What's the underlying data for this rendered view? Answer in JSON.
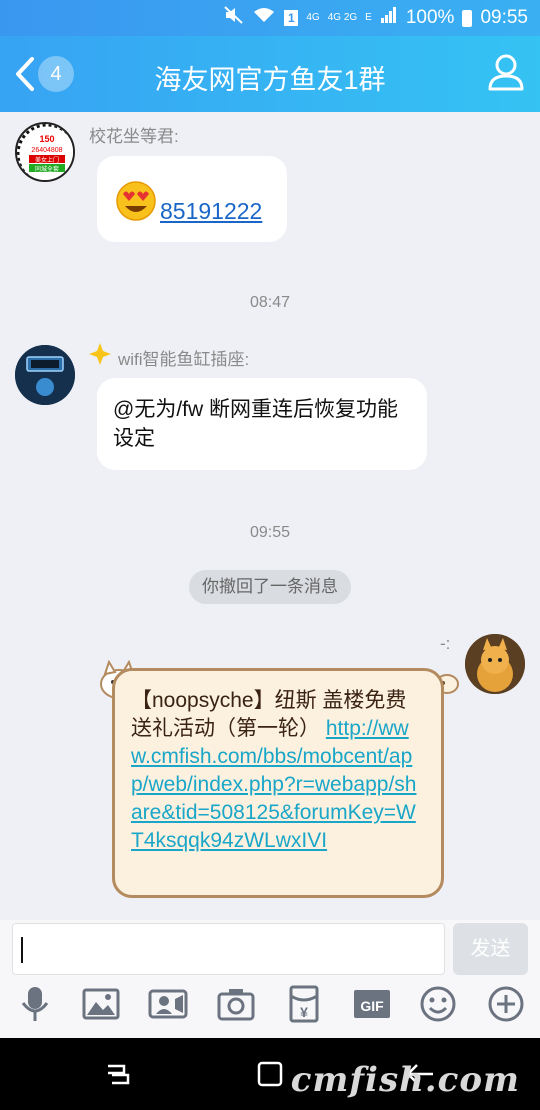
{
  "status_bar": {
    "network_4g": "4G",
    "network_4g2g": "4G 2G",
    "network_e": "E",
    "sim_index": "1",
    "battery": "100%",
    "time": "09:55"
  },
  "header": {
    "back_badge": "4",
    "title": "海友网官方鱼友1群"
  },
  "messages": [
    {
      "sender": "校花坐等君:",
      "avatar_text": [
        "150",
        "26404808",
        "美女上门",
        "同城全套"
      ],
      "emoji": "heart-eyes-emoji",
      "text": "85191222"
    },
    {
      "time": "08:47"
    },
    {
      "sender": "wifi智能鱼缸插座:",
      "text": "@无为/fw 断网重连后恢复功能设定"
    },
    {
      "time": "09:55"
    },
    {
      "system": "你撤回了一条消息"
    },
    {
      "sender": "-:",
      "card_prefix": "【noopsyche】纽斯 盖楼免费送礼活动（第一轮） ",
      "card_link": "http://www.cmfish.com/bbs/mobcent/app/web/index.php?r=webapp/share&tid=508125&forumKey=WT4ksqqk94zWLwxIVI"
    }
  ],
  "input": {
    "value": "",
    "send_label": "发送"
  },
  "toolbar": {
    "gif_label": "GIF",
    "yen_label": "¥",
    "items": [
      "microphone-icon",
      "image-icon",
      "video-call-icon",
      "camera-icon",
      "red-packet-icon",
      "gif-icon",
      "emoji-icon",
      "plus-icon"
    ]
  },
  "watermark": "cmfish.com",
  "colors": {
    "header_start": "#37a3f3",
    "header_end": "#35c3f3",
    "background": "#eef0f5",
    "link": "#1a66c8",
    "card_bg": "#fcf1df",
    "card_border": "#b38b5e"
  }
}
